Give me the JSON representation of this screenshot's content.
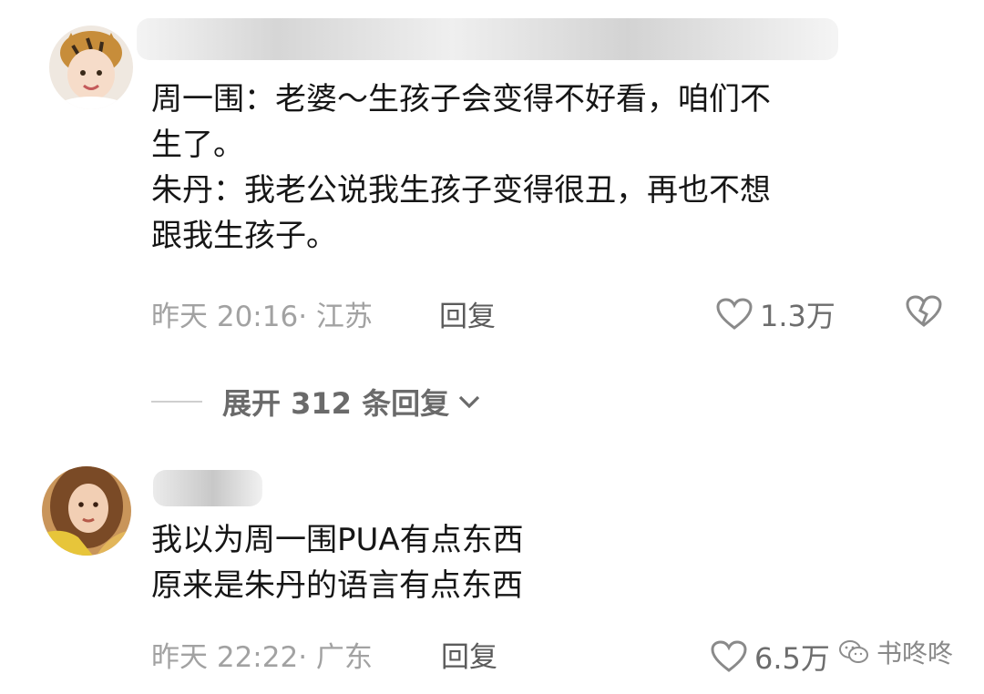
{
  "comments": [
    {
      "lines": [
        "周一围：老婆～生孩子会变得不好看，咱们不",
        "生了。",
        "朱丹：我老公说我生孩子变得很丑，再也不想",
        "跟我生孩子。"
      ],
      "time_location": "昨天 20:16· 江苏",
      "reply_label": "回复",
      "like_count": "1.3万"
    },
    {
      "lines": [
        "我以为周一围PUA有点东西",
        "原来是朱丹的语言有点东西"
      ],
      "time_location": "昨天 22:22· 广东",
      "reply_label": "回复",
      "like_count": "6.5万"
    }
  ],
  "expand_replies": {
    "label": "展开 312 条回复"
  },
  "watermark": {
    "text": "书咚咚"
  },
  "icons": {
    "like": "heart-outline-icon",
    "dislike": "broken-heart-icon",
    "expand": "chevron-down-icon",
    "watermark": "wechat-icon"
  },
  "colors": {
    "text": "#161616",
    "meta": "#a2a2a2",
    "reply": "#5b5b5b",
    "like": "#6d6d6d"
  }
}
